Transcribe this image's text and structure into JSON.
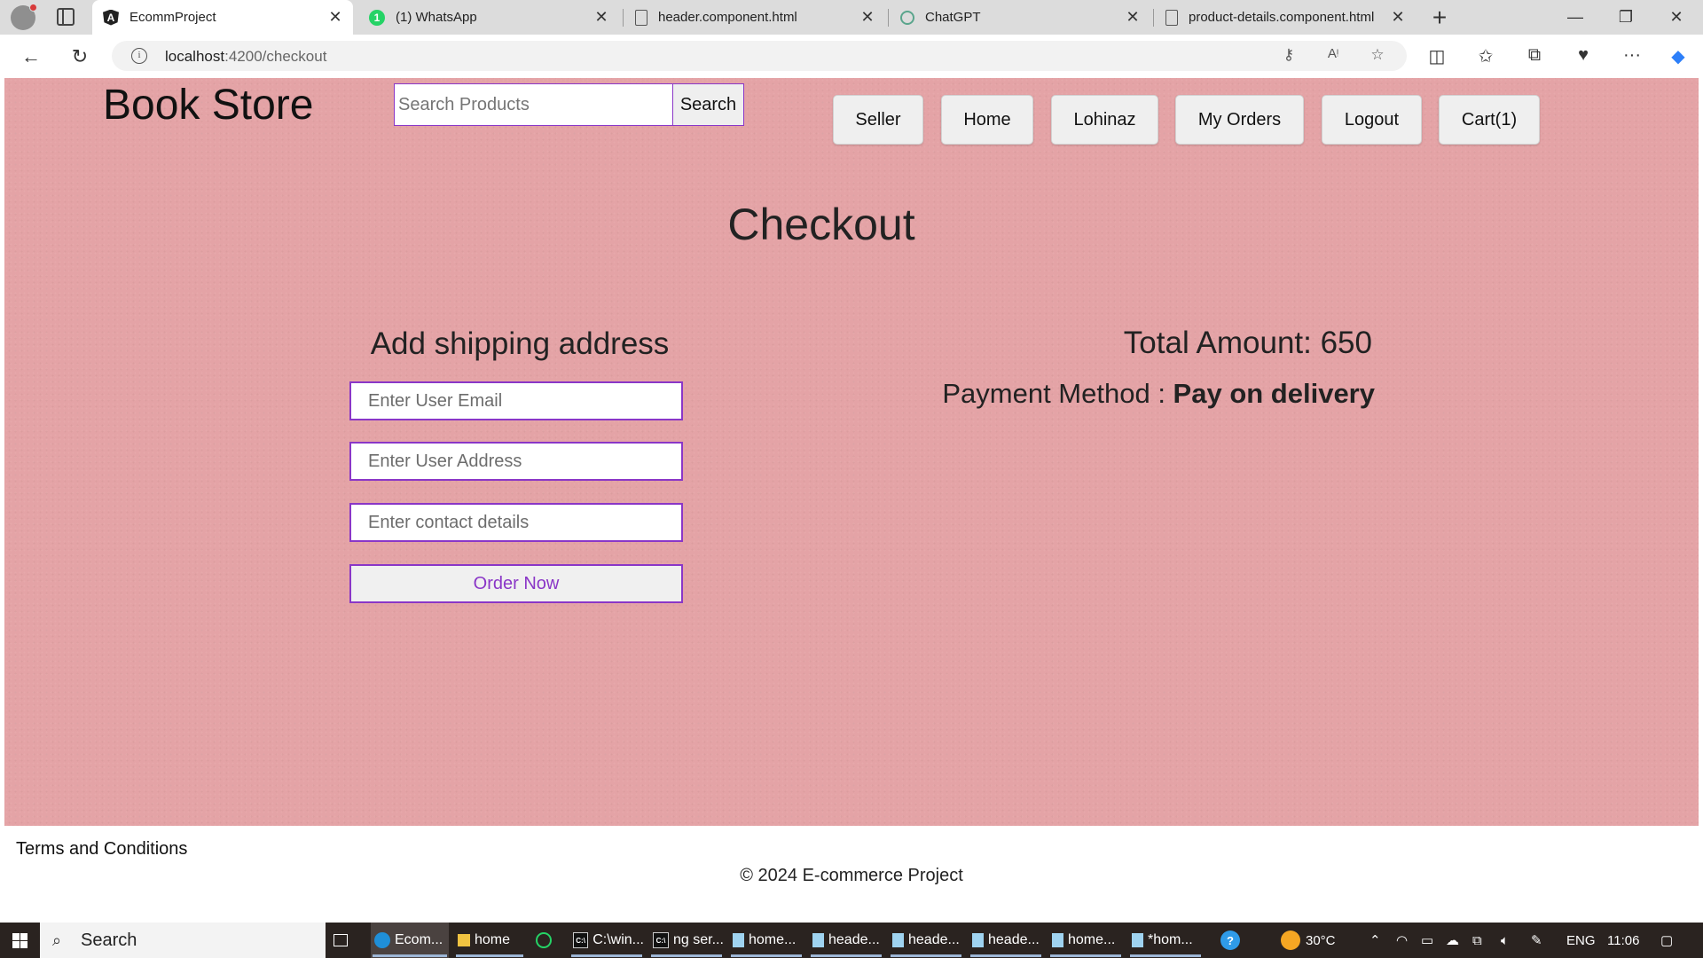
{
  "browser": {
    "tabs": [
      {
        "title": "EcommProject",
        "icon": "angular-icon"
      },
      {
        "title": "(1) WhatsApp",
        "icon": "whatsapp-icon",
        "badge": "1"
      },
      {
        "title": "header.component.html",
        "icon": "file-icon"
      },
      {
        "title": "ChatGPT",
        "icon": "chatgpt-icon"
      },
      {
        "title": "product-details.component.html",
        "icon": "file-icon"
      }
    ],
    "url_host": "localhost",
    "url_path": ":4200/checkout"
  },
  "header": {
    "brand": "Book Store",
    "search_placeholder": "Search Products",
    "search_button": "Search",
    "nav": [
      "Seller",
      "Home",
      "Lohinaz",
      "My Orders",
      "Logout",
      "Cart(1)"
    ]
  },
  "checkout": {
    "title": "Checkout",
    "shipping_title": "Add shipping address",
    "email_placeholder": "Enter User Email",
    "address_placeholder": "Enter User Address",
    "contact_placeholder": "Enter contact details",
    "order_button": "Order Now",
    "total_label": "Total Amount: 650",
    "payment_label": "Payment Method : ",
    "payment_value": "Pay on delivery"
  },
  "footer": {
    "terms": "Terms and Conditions",
    "copyright": "© 2024 E-commerce Project"
  },
  "taskbar": {
    "search": "Search",
    "items": [
      "Ecom...",
      "home",
      "C:\\win...",
      "ng ser...",
      "home...",
      "heade...",
      "heade...",
      "heade...",
      "home...",
      "*hom..."
    ],
    "weather": "30°C",
    "lang": "ENG",
    "time": "11:06"
  },
  "colors": {
    "page_background": "#e4a3a6",
    "accent_purple": "#8a36c7"
  }
}
